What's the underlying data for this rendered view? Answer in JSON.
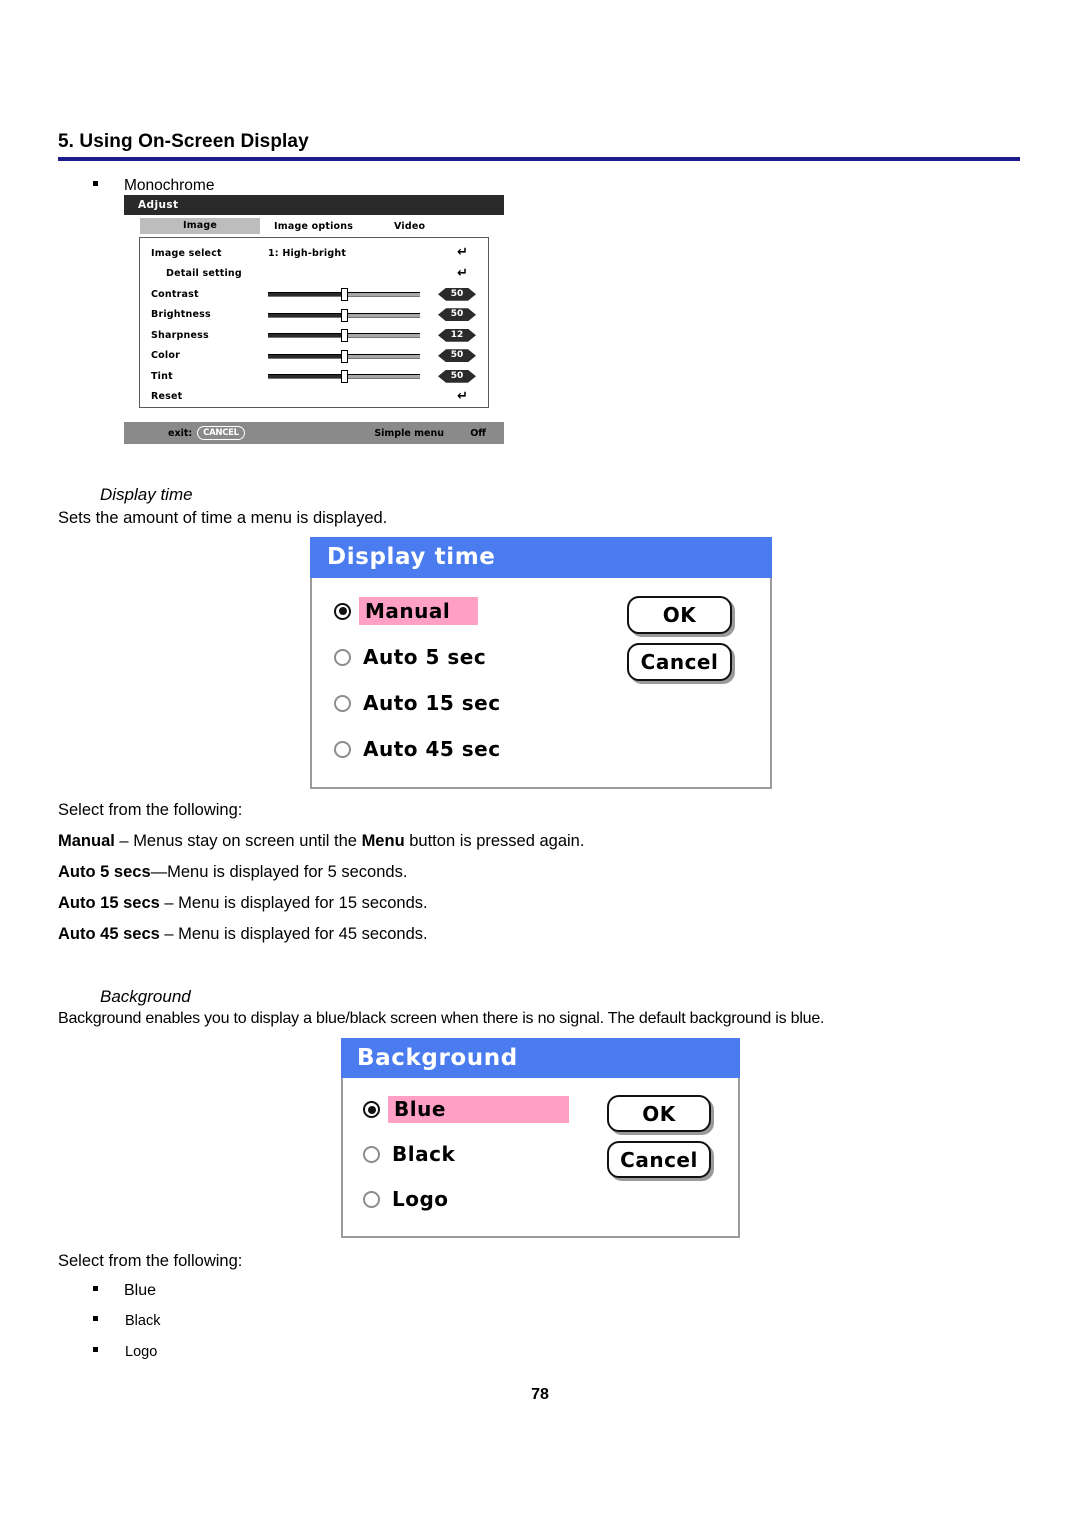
{
  "page": {
    "chapter_title": "5. Using On-Screen Display",
    "page_number": "78"
  },
  "monochrome_note": {
    "bullet_label": "Monochrome"
  },
  "osd_menu": {
    "title": "Adjust",
    "tabs": [
      "Image",
      "Image options",
      "Video"
    ],
    "rows": [
      {
        "label": "Image select",
        "value": "1: High-bright",
        "enter": "↵"
      },
      {
        "label": "Detail setting",
        "value": "",
        "enter": "↵"
      },
      {
        "label": "Contrast",
        "value": "50"
      },
      {
        "label": "Brightness",
        "value": "50"
      },
      {
        "label": "Sharpness",
        "value": "12"
      },
      {
        "label": "Color",
        "value": "50"
      },
      {
        "label": "Tint",
        "value": "50"
      },
      {
        "label": "Reset",
        "value": "",
        "enter": "↵"
      }
    ],
    "footer": {
      "exit_label": "exit:",
      "cancel_key": "CANCEL",
      "simple_menu_label": "Simple menu",
      "simple_menu_value": "Off"
    }
  },
  "display_time_section": {
    "heading": "Display time",
    "intro": "Sets the amount of time a menu is displayed.",
    "dialog": {
      "title": "Display time",
      "options": [
        {
          "label": "Manual",
          "selected": true
        },
        {
          "label": "Auto  5 sec",
          "selected": false
        },
        {
          "label": "Auto 15 sec",
          "selected": false
        },
        {
          "label": "Auto 45 sec",
          "selected": false
        }
      ],
      "ok_label": "OK",
      "cancel_label": "Cancel"
    },
    "select_prompt": "Select from the following:",
    "descriptions": [
      {
        "term": "Manual",
        "rest": " – Menus stay on screen until the ",
        "emphasis": "Menu",
        "tail": " button is pressed again."
      },
      {
        "term": "Auto 5 secs",
        "rest": "—Menu is displayed for 5 seconds.",
        "emphasis": "",
        "tail": ""
      },
      {
        "term": "Auto 15 secs",
        "rest": " – Menu is displayed for 15 seconds.",
        "emphasis": "",
        "tail": ""
      },
      {
        "term": "Auto 45 secs",
        "rest": " – Menu is displayed for 45 seconds.",
        "emphasis": "",
        "tail": ""
      }
    ]
  },
  "background_section": {
    "heading": "Background",
    "intro": "Background enables you to display a blue/black screen when there is no signal. The default background is blue.",
    "dialog": {
      "title": "Background",
      "options": [
        {
          "label": "Blue",
          "selected": true
        },
        {
          "label": "Black",
          "selected": false
        },
        {
          "label": "Logo",
          "selected": false
        }
      ],
      "ok_label": "OK",
      "cancel_label": "Cancel"
    },
    "select_prompt": "Select from the following:",
    "bullets": [
      "Blue",
      "Black",
      "Logo"
    ]
  },
  "colors": {
    "dialog_title_blue": "#4a7cf0",
    "highlight_pink": "#ffa0c4",
    "header_rule_navy": "#1c1c8c",
    "osd_title_bar": "#2a2a2a",
    "osd_footer": "#8a8a8a"
  }
}
